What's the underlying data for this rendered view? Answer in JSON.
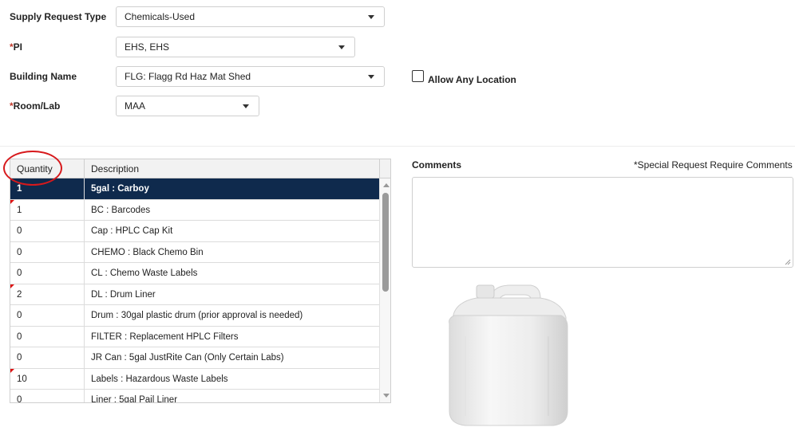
{
  "form": {
    "supply_request_type": {
      "label": "Supply Request Type",
      "value": "Chemicals-Used"
    },
    "pi": {
      "required_mark": "*",
      "label": "PI",
      "value": "EHS, EHS"
    },
    "building_name": {
      "label": "Building Name",
      "value": "FLG: Flagg Rd Haz Mat Shed"
    },
    "allow_any_location": {
      "label": "Allow Any Location",
      "checked": false
    },
    "room_lab": {
      "required_mark": "*",
      "label": "Room/Lab",
      "value": "MAA"
    }
  },
  "grid": {
    "columns": [
      "Quantity",
      "Description"
    ],
    "rows": [
      {
        "quantity": "1",
        "description": "5gal : Carboy",
        "selected": true,
        "flag": false
      },
      {
        "quantity": "1",
        "description": "BC : Barcodes",
        "selected": false,
        "flag": true
      },
      {
        "quantity": "0",
        "description": "Cap : HPLC Cap Kit",
        "selected": false,
        "flag": false
      },
      {
        "quantity": "0",
        "description": "CHEMO : Black Chemo Bin",
        "selected": false,
        "flag": false
      },
      {
        "quantity": "0",
        "description": "CL : Chemo Waste Labels",
        "selected": false,
        "flag": false
      },
      {
        "quantity": "2",
        "description": "DL : Drum Liner",
        "selected": false,
        "flag": true
      },
      {
        "quantity": "0",
        "description": "Drum : 30gal plastic drum (prior approval is needed)",
        "selected": false,
        "flag": false
      },
      {
        "quantity": "0",
        "description": "FILTER : Replacement HPLC Filters",
        "selected": false,
        "flag": false
      },
      {
        "quantity": "0",
        "description": "JR Can : 5gal JustRite Can (Only Certain Labs)",
        "selected": false,
        "flag": false
      },
      {
        "quantity": "10",
        "description": "Labels : Hazardous Waste Labels",
        "selected": false,
        "flag": true
      },
      {
        "quantity": "0",
        "description": "Liner : 5gal Pail Liner",
        "selected": false,
        "flag": false
      }
    ]
  },
  "comments": {
    "label": "Comments",
    "note": "*Special Request Require Comments",
    "value": ""
  },
  "image": {
    "icon": "carboy-icon"
  },
  "colors": {
    "selected_row": "#0f2a4d",
    "required": "#c0392b",
    "highlight_circle": "#d7191c"
  }
}
